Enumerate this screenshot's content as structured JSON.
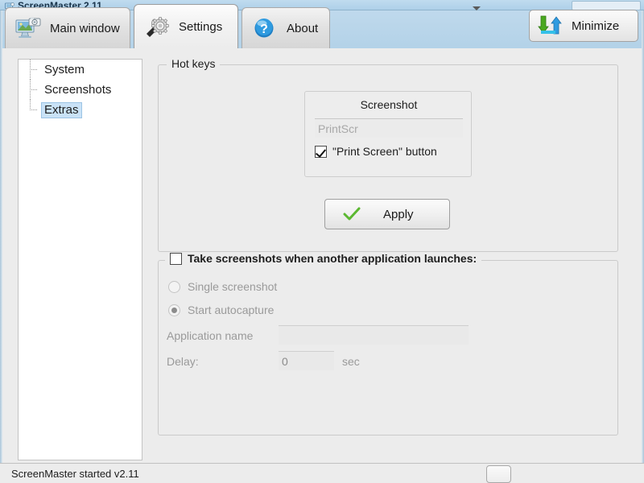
{
  "window": {
    "title": "ScreenMaster 2.11",
    "icon": "app-icon"
  },
  "tabs": [
    {
      "label": "Main window",
      "icon": "monitor-camera-icon",
      "active": false
    },
    {
      "label": "Settings",
      "icon": "gear-wrench-icon",
      "active": true
    },
    {
      "label": "About",
      "icon": "question-mark-icon",
      "active": false
    }
  ],
  "minimize": {
    "label": "Minimize",
    "icon": "minimize-arrows-icon"
  },
  "sidebar": {
    "items": [
      {
        "label": "System",
        "selected": false
      },
      {
        "label": "Screenshots",
        "selected": false
      },
      {
        "label": "Extras",
        "selected": true
      }
    ]
  },
  "hotkeys": {
    "title": "Hot keys",
    "screenshot_panel": {
      "title": "Screenshot",
      "hotkey_value": "PrintScr",
      "hotkey_placeholder": "PrintScr",
      "checkbox": {
        "label": "\"Print Screen\" button",
        "checked": true
      }
    },
    "apply_button": {
      "label": "Apply",
      "icon": "green-check-icon"
    }
  },
  "autolaunch": {
    "title": "Take screenshots when another application launches:",
    "enabled": false,
    "options": [
      {
        "label": "Single screenshot",
        "selected": false
      },
      {
        "label": "Start autocapture",
        "selected": true
      }
    ],
    "app_name_label": "Application name",
    "app_name_value": "",
    "app_name_placeholder": "",
    "delay_label": "Delay:",
    "delay_value": "0",
    "delay_unit": "sec"
  },
  "status_bar": {
    "text": "ScreenMaster started v2.11"
  },
  "colors": {
    "title_bar": "#bcd9ee",
    "tab_strip": "#b9d5ea",
    "background": "#ececec",
    "selection": "#c9e2f7",
    "accent_green": "#5bb831",
    "accent_blue": "#2f8fd8",
    "disabled_text": "#9a9a9a"
  }
}
